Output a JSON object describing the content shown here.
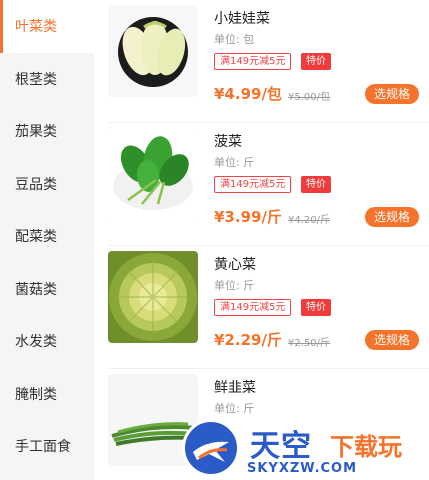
{
  "sidebar": {
    "categories": [
      {
        "label": "叶菜类",
        "active": true
      },
      {
        "label": "根茎类",
        "active": false
      },
      {
        "label": "茄果类",
        "active": false
      },
      {
        "label": "豆品类",
        "active": false
      },
      {
        "label": "配菜类",
        "active": false
      },
      {
        "label": "菌菇类",
        "active": false
      },
      {
        "label": "水发类",
        "active": false
      },
      {
        "label": "腌制类",
        "active": false
      },
      {
        "label": "手工面食",
        "active": false
      }
    ]
  },
  "products": [
    {
      "name": "小娃娃菜",
      "unit": "单位: 包",
      "promo": "满149元减5元",
      "tag": "特价",
      "price": "¥4.99/包",
      "old_price": "¥5.00/包",
      "button": "选规格",
      "image": "baby-cabbage-image"
    },
    {
      "name": "菠菜",
      "unit": "单位: 斤",
      "promo": "满149元减5元",
      "tag": "特价",
      "price": "¥3.99/斤",
      "old_price": "¥4.20/斤",
      "button": "选规格",
      "image": "spinach-image"
    },
    {
      "name": "黄心菜",
      "unit": "单位: 斤",
      "promo": "满149元减5元",
      "tag": "特价",
      "price": "¥2.29/斤",
      "old_price": "¥2.50/斤",
      "button": "选规格",
      "image": "yellow-heart-cabbage-image"
    },
    {
      "name": "鲜韭菜",
      "unit": "单位: 斤",
      "image": "chives-image"
    }
  ],
  "watermark": {
    "title_blue": "天空",
    "title_orange": "下载玩",
    "url": "SKYXZW.COM"
  },
  "colors": {
    "accent": "#f5732b",
    "promo_red": "#ef3b3b",
    "sidebar_bg": "#f5f5f5"
  }
}
